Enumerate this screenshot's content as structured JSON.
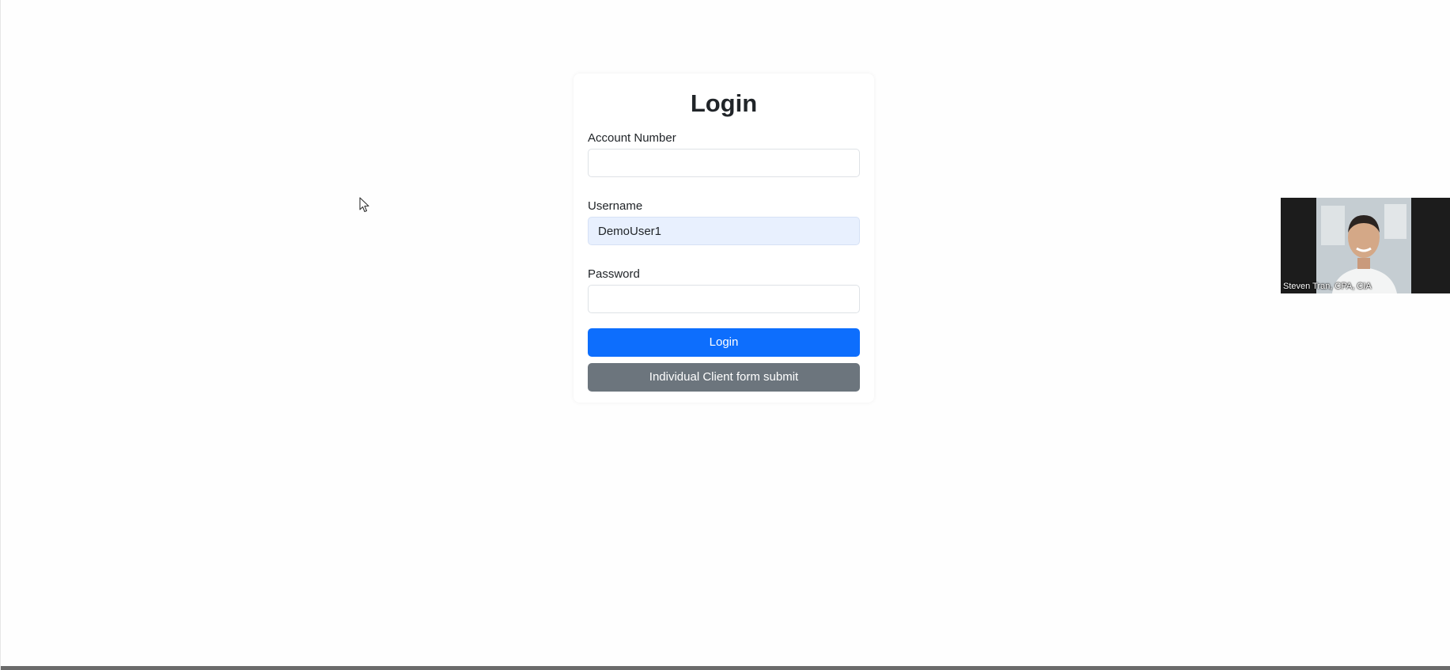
{
  "login": {
    "title": "Login",
    "fields": {
      "account_number": {
        "label": "Account Number",
        "value": ""
      },
      "username": {
        "label": "Username",
        "value": "DemoUser1"
      },
      "password": {
        "label": "Password",
        "value": ""
      }
    },
    "login_button": "Login",
    "client_form_button": "Individual Client form submit"
  },
  "video": {
    "participant_name": "Steven Tran, CPA, CIA"
  },
  "colors": {
    "primary": "#0d6efd",
    "secondary": "#6c757d",
    "autofill": "#e8f0fe"
  },
  "icons": {
    "cursor": "mouse-pointer-icon"
  }
}
